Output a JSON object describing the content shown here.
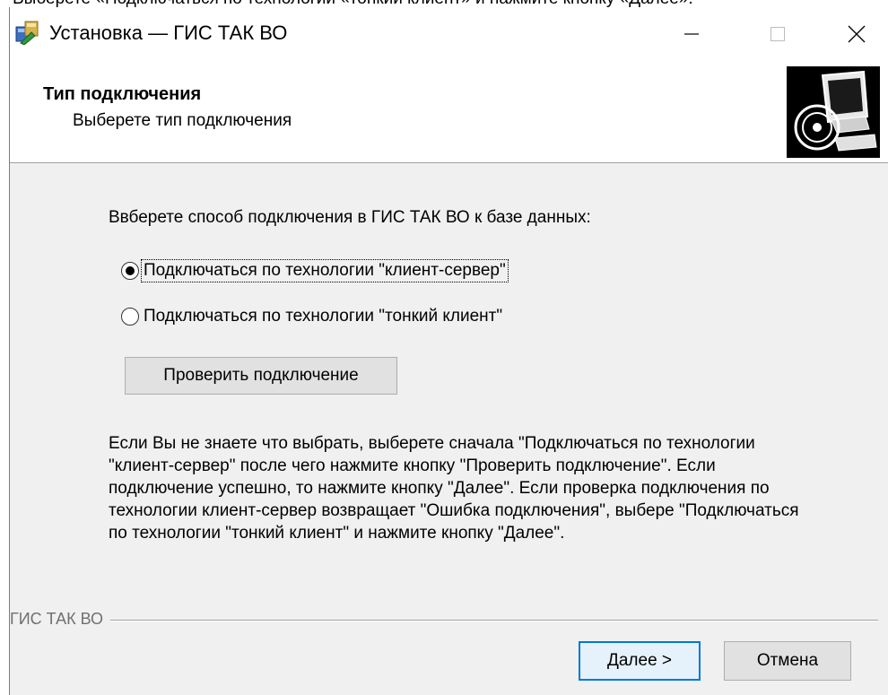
{
  "caption": "Выберете «Подключаться по технологии «тонкий клиент» и нажмите кнопку «Далее».",
  "window": {
    "title": "Установка — ГИС ТАК ВО",
    "icon": "installer-icon"
  },
  "header": {
    "title": "Тип подключения",
    "subtitle": "Выберете тип подключения",
    "image": "computer-install-icon"
  },
  "body": {
    "prompt": "Ввберете способ подключения в ГИС ТАК ВО к базе данных:",
    "options": [
      {
        "label": "Подключаться по технологии \"клиент-сервер\"",
        "checked": true
      },
      {
        "label": "Подключаться по технологии \"тонкий клиент\"",
        "checked": false
      }
    ],
    "check_button": "Проверить подключение",
    "help_text": "Если Вы не знаете что выбрать, выберете сначала \"Подключаться по технологии \"клиент-сервер\" после чего нажмите кнопку \"Проверить подключение\". Если подключение успешно, то нажмите кнопку \"Далее\". Если проверка подключения по технологии клиент-сервер возвращает \"Ошибка подключения\", выбере \"Подключаться по технологии \"тонкий клиент\" и нажмите кнопку \"Далее\"."
  },
  "footer": {
    "group_label": "ГИС ТАК ВО",
    "next_accel": "Д",
    "next_rest": "алее >",
    "cancel": "Отмена"
  },
  "colors": {
    "accent": "#0078d7",
    "dialog_bg": "#f0f0f0"
  }
}
